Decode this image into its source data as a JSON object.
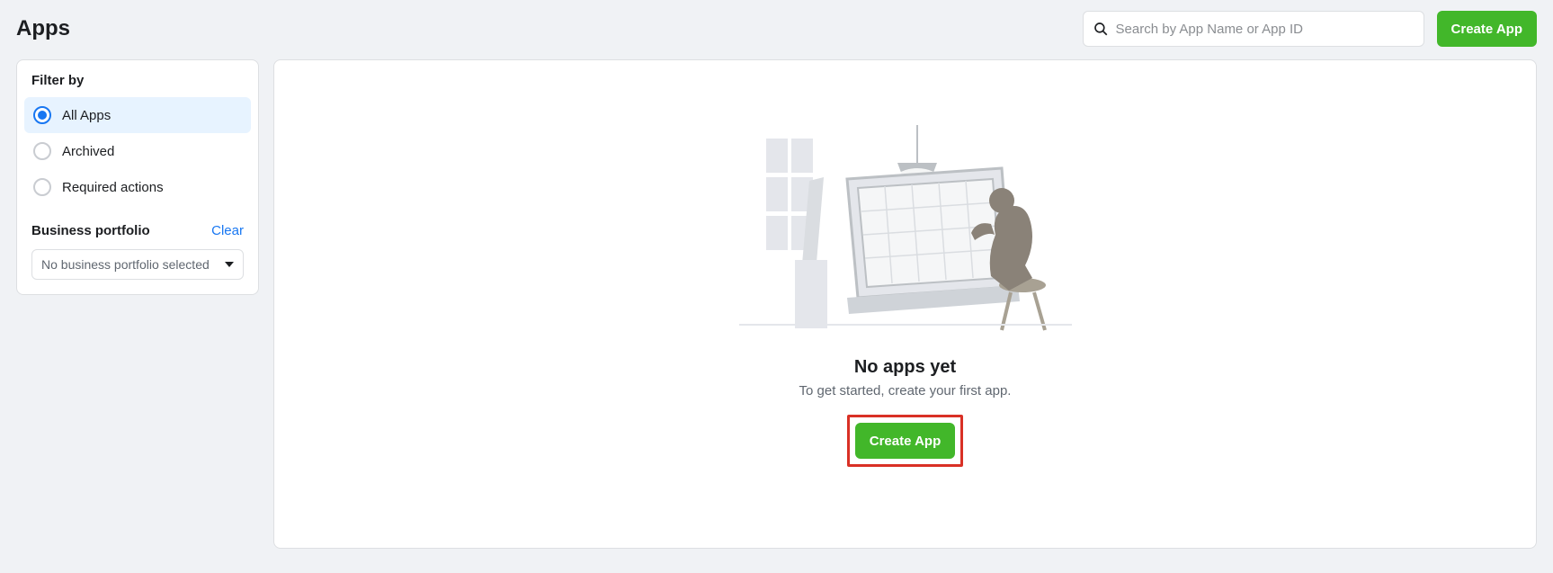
{
  "header": {
    "title": "Apps",
    "search_placeholder": "Search by App Name or App ID",
    "create_button": "Create App"
  },
  "sidebar": {
    "filter_title": "Filter by",
    "filters": [
      {
        "label": "All Apps",
        "selected": true
      },
      {
        "label": "Archived",
        "selected": false
      },
      {
        "label": "Required actions",
        "selected": false
      }
    ],
    "portfolio_title": "Business portfolio",
    "clear_label": "Clear",
    "portfolio_selected": "No business portfolio selected"
  },
  "main": {
    "empty_title": "No apps yet",
    "empty_subtitle": "To get started, create your first app.",
    "create_button": "Create App"
  },
  "colors": {
    "primary_green": "#42b72a",
    "link_blue": "#1877f2",
    "highlight_red": "#d93025"
  }
}
